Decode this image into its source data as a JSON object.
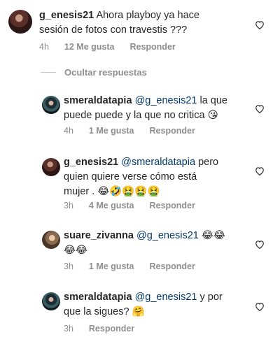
{
  "comments": [
    {
      "username": "g_enesis21",
      "mention": "",
      "text_lines": [
        "Ahora playboy ya hace",
        "sesión de fotos con travestis ???"
      ],
      "time": "4h",
      "likes": "12 Me gusta",
      "reply_label": "Responder",
      "avatar": "g-enesis21-avatar"
    },
    {
      "username": "smeraldatapia",
      "mention": "@g_enesis21",
      "text_lines": [
        "la que",
        "puede puede y la que no critica 😘"
      ],
      "time": "4h",
      "likes": "1 Me gusta",
      "reply_label": "Responder",
      "avatar": "smeraldatapia-avatar"
    },
    {
      "username": "g_enesis21",
      "mention": "@smeraldatapia",
      "text_lines": [
        "pero",
        "quien quiere verse cómo está",
        "mujer . 😂🤣🤮🤮🤮"
      ],
      "time": "3h",
      "likes": "4 Me gusta",
      "reply_label": "Responder",
      "avatar": "g-enesis21-avatar"
    },
    {
      "username": "suare_zivanna",
      "mention": "@g_enesis21",
      "text_lines": [
        "😂😂",
        "😂😂"
      ],
      "time": "3h",
      "likes": "1 Me gusta",
      "reply_label": "Responder",
      "avatar": "suare-zivanna-avatar"
    },
    {
      "username": "smeraldatapia",
      "mention": "@g_enesis21",
      "text_lines": [
        "y por",
        "que la sigues? 🤗"
      ],
      "time": "3h",
      "likes": "",
      "reply_label": "Responder",
      "avatar": "smeraldatapia-avatar"
    }
  ],
  "hide_replies_label": "Ocultar respuestas",
  "colors": {
    "text": "#262626",
    "meta": "#8e8e8e",
    "mention": "#00376b"
  }
}
